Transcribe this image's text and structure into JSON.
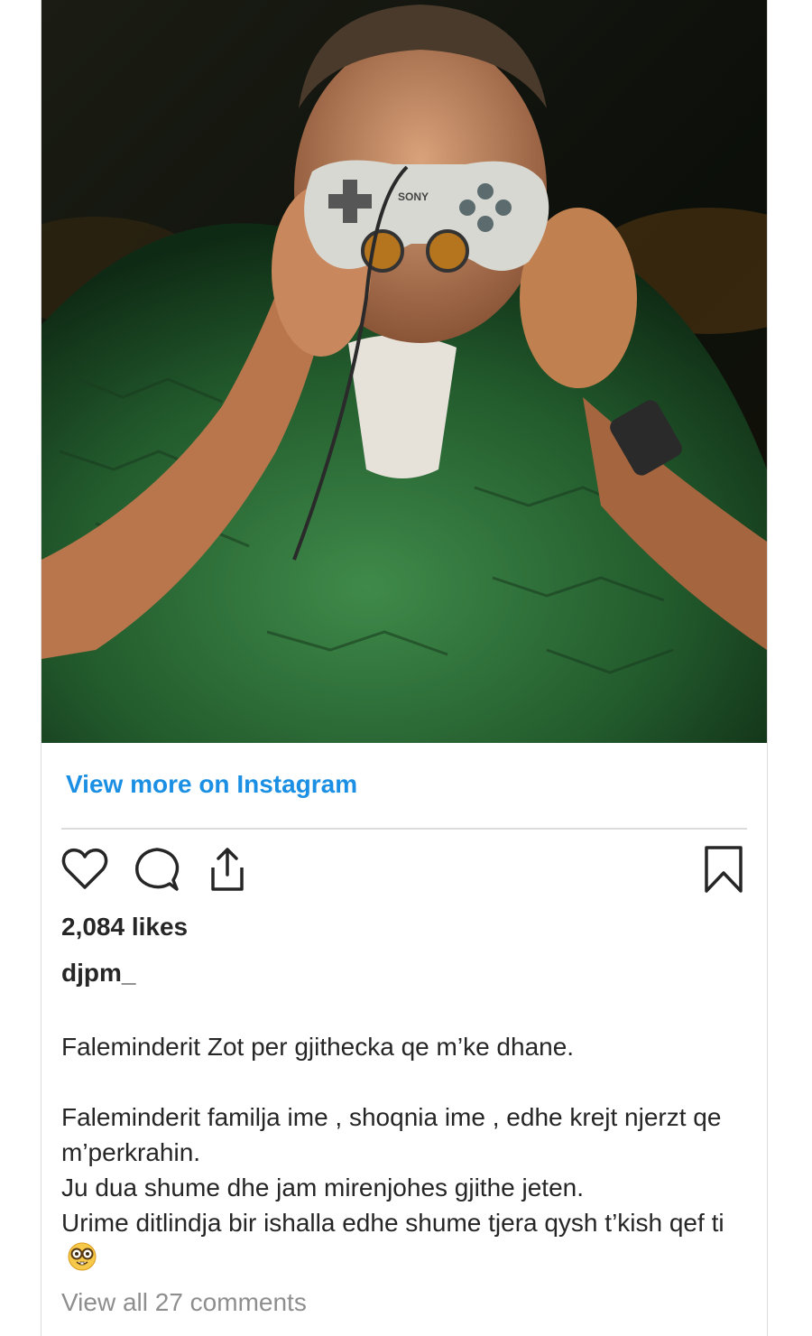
{
  "post": {
    "image_alt": "Man in green jacket holding a SONY game controller in front of his face",
    "controller_brand": "SONY",
    "view_more_label": "View more on Instagram",
    "likes_text": "2,084 likes",
    "username": "djpm_",
    "caption": {
      "line1": "Faleminderit Zot per gjithecka qe m’ke dhane.",
      "line2": "Faleminderit familja ime , shoqnia ime , edhe krejt njerzt qe m’perkrahin.",
      "line3": "Ju dua shume dhe jam mirenjohes gjithe jeten.",
      "line4": "Urime ditlindja bir ishalla edhe shume tjera qysh t’kish qef ti"
    },
    "emoji_icon": "nerd-face-emoji-icon",
    "comments_link": "View all 27 comments"
  },
  "icons": {
    "like": "heart-icon",
    "comment": "comment-bubble-icon",
    "share": "share-upload-icon",
    "save": "bookmark-icon"
  },
  "colors": {
    "link_blue": "#1a8fe3",
    "text": "#262626",
    "muted": "#8e8e8e",
    "jacket_green": "#2f6b38"
  }
}
